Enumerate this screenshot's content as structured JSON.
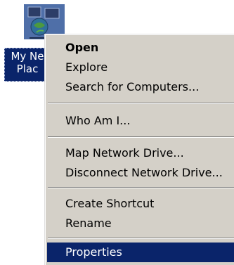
{
  "desktop_icon": {
    "label": "My Network Places",
    "visible_label": "My Ne\nPlac",
    "icon": "network-places-icon"
  },
  "menu": {
    "items": [
      {
        "label": "Open",
        "default": true
      },
      {
        "label": "Explore"
      },
      {
        "label": "Search for Computers..."
      },
      {
        "label": "Who Am I..."
      },
      {
        "label": "Map Network Drive..."
      },
      {
        "label": "Disconnect Network Drive..."
      },
      {
        "label": "Create Shortcut"
      },
      {
        "label": "Rename"
      },
      {
        "label": "Properties",
        "selected": true
      }
    ]
  },
  "colors": {
    "menu_bg": "#d4d0c8",
    "selection": "#0a246a",
    "desktop": "#ffffff"
  }
}
